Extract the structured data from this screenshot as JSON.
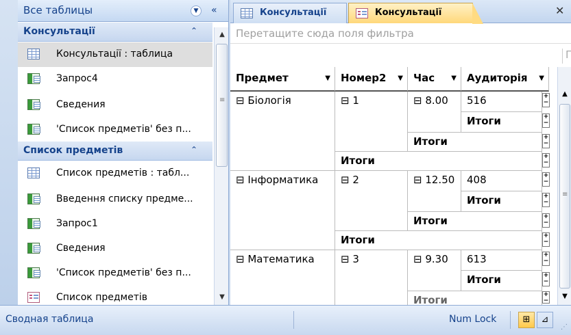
{
  "nav": {
    "header_title": "Все таблицы",
    "groups": [
      {
        "label": "Консультації",
        "items": [
          {
            "label": "Консультації : таблица",
            "icon": "table-icon",
            "selected": true
          },
          {
            "label": "Запрос4",
            "icon": "query-icon"
          },
          {
            "label": "Сведения",
            "icon": "query-icon"
          },
          {
            "label": "'Список предметів' без п...",
            "icon": "query-icon"
          }
        ]
      },
      {
        "label": "Список предметів",
        "items": [
          {
            "label": "Список предметів : табл...",
            "icon": "table-icon"
          },
          {
            "label": "Введення списку предме...",
            "icon": "query-icon"
          },
          {
            "label": "Запрос1",
            "icon": "query-icon"
          },
          {
            "label": "Сведения",
            "icon": "query-icon"
          },
          {
            "label": "'Список предметів' без п...",
            "icon": "query-icon"
          },
          {
            "label": "Список предметів",
            "icon": "form-icon"
          }
        ]
      }
    ]
  },
  "tabs": [
    {
      "label": "Консультації",
      "icon": "table-icon",
      "active": false
    },
    {
      "label": "Консультації",
      "icon": "form-icon",
      "active": true
    }
  ],
  "pivot": {
    "filter_placeholder": "Перетащите сюда поля фильтра",
    "col_area_cut": "П",
    "headers": [
      "Предмет",
      "Номер2",
      "Час",
      "Аудиторія"
    ],
    "totals_label": "Итоги",
    "rows": [
      {
        "subject": "Біологія",
        "number": "1",
        "time": "8.00",
        "room": "516"
      },
      {
        "subject": "Інформатика",
        "number": "2",
        "time": "12.50",
        "room": "408"
      },
      {
        "subject": "Математика",
        "number": "3",
        "time": "9.30",
        "room": "613"
      }
    ]
  },
  "status": {
    "view_name": "Сводная таблица",
    "numlock": "Num Lock"
  },
  "colors": {
    "accent": "#15428b",
    "active_tab": "#ffd87a",
    "border": "#8eaad4"
  }
}
